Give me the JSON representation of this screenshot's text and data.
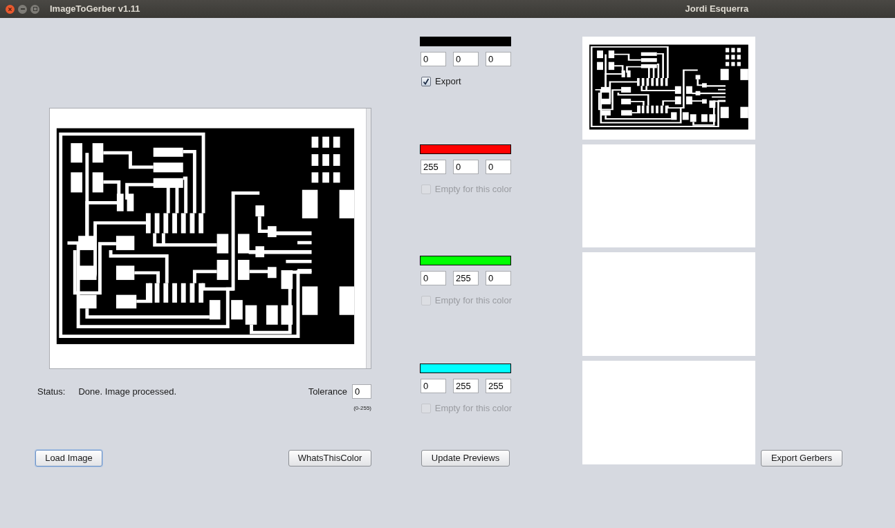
{
  "window": {
    "title": "ImageToGerber v1.11",
    "user": "Jordi Esquerra"
  },
  "image_panel": {
    "kind": "pcb"
  },
  "status": {
    "label": "Status:",
    "text": "Done. Image processed."
  },
  "tolerance": {
    "label": "Tolerance",
    "value": "0",
    "range": "(0-255)"
  },
  "left_buttons": [
    {
      "label": "Load Image",
      "focused": true
    },
    {
      "label": "WhatsThisColor",
      "focused": false
    }
  ],
  "colors": [
    {
      "color": "#000000",
      "values": [
        "0",
        "0",
        "0"
      ],
      "option": {
        "label": "Export",
        "checked": true,
        "disabled": false
      }
    },
    {
      "color": "#ff0000",
      "values": [
        "255",
        "0",
        "0"
      ],
      "option": {
        "label": "Empty for this color",
        "checked": false,
        "disabled": true
      }
    },
    {
      "color": "#00ff00",
      "values": [
        "0",
        "255",
        "0"
      ],
      "option": {
        "label": "Empty for this color",
        "checked": false,
        "disabled": true
      }
    },
    {
      "color": "#00ffff",
      "values": [
        "0",
        "255",
        "255"
      ],
      "option": {
        "label": "Empty for this color",
        "checked": false,
        "disabled": true
      }
    }
  ],
  "update_button": {
    "label": "Update Previews",
    "focused": false
  },
  "previews": [
    {
      "kind": "pcb"
    },
    {
      "kind": "empty"
    },
    {
      "kind": "empty"
    },
    {
      "kind": "empty"
    }
  ],
  "export_button": {
    "label": "Export Gerbers",
    "focused": false
  }
}
